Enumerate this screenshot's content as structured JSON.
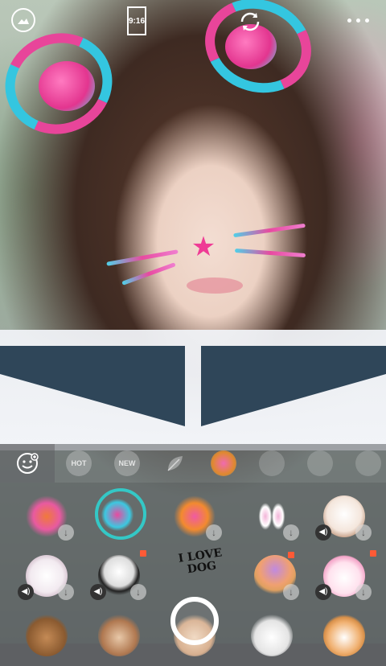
{
  "top_bar": {
    "ratio_label": "9:16",
    "icons": [
      "gallery-icon",
      "aspect-ratio-icon",
      "switch-camera-icon",
      "more-icon"
    ]
  },
  "sticker_panel": {
    "categories": [
      {
        "id": "favorites",
        "icon": "smiley-face-icon"
      },
      {
        "id": "hot",
        "label": "HOT"
      },
      {
        "id": "new",
        "label": "NEW"
      },
      {
        "id": "leaf",
        "icon": "leaf-icon"
      },
      {
        "id": "glitter-ears",
        "icon": "sticker-thumbnail-icon",
        "selected": true
      },
      {
        "id": "flowers",
        "icon": "sticker-thumbnail-icon"
      },
      {
        "id": "pudding",
        "icon": "sticker-thumbnail-icon"
      },
      {
        "id": "mask",
        "icon": "sticker-thumbnail-icon"
      }
    ],
    "love_dog_text": "I LOVE DOG"
  },
  "colors": {
    "accent_ring": "#34c8c6",
    "new_badge": "#ff5a36",
    "sparkle_pink": "#e8459a",
    "sparkle_cyan": "#34c6e0"
  }
}
